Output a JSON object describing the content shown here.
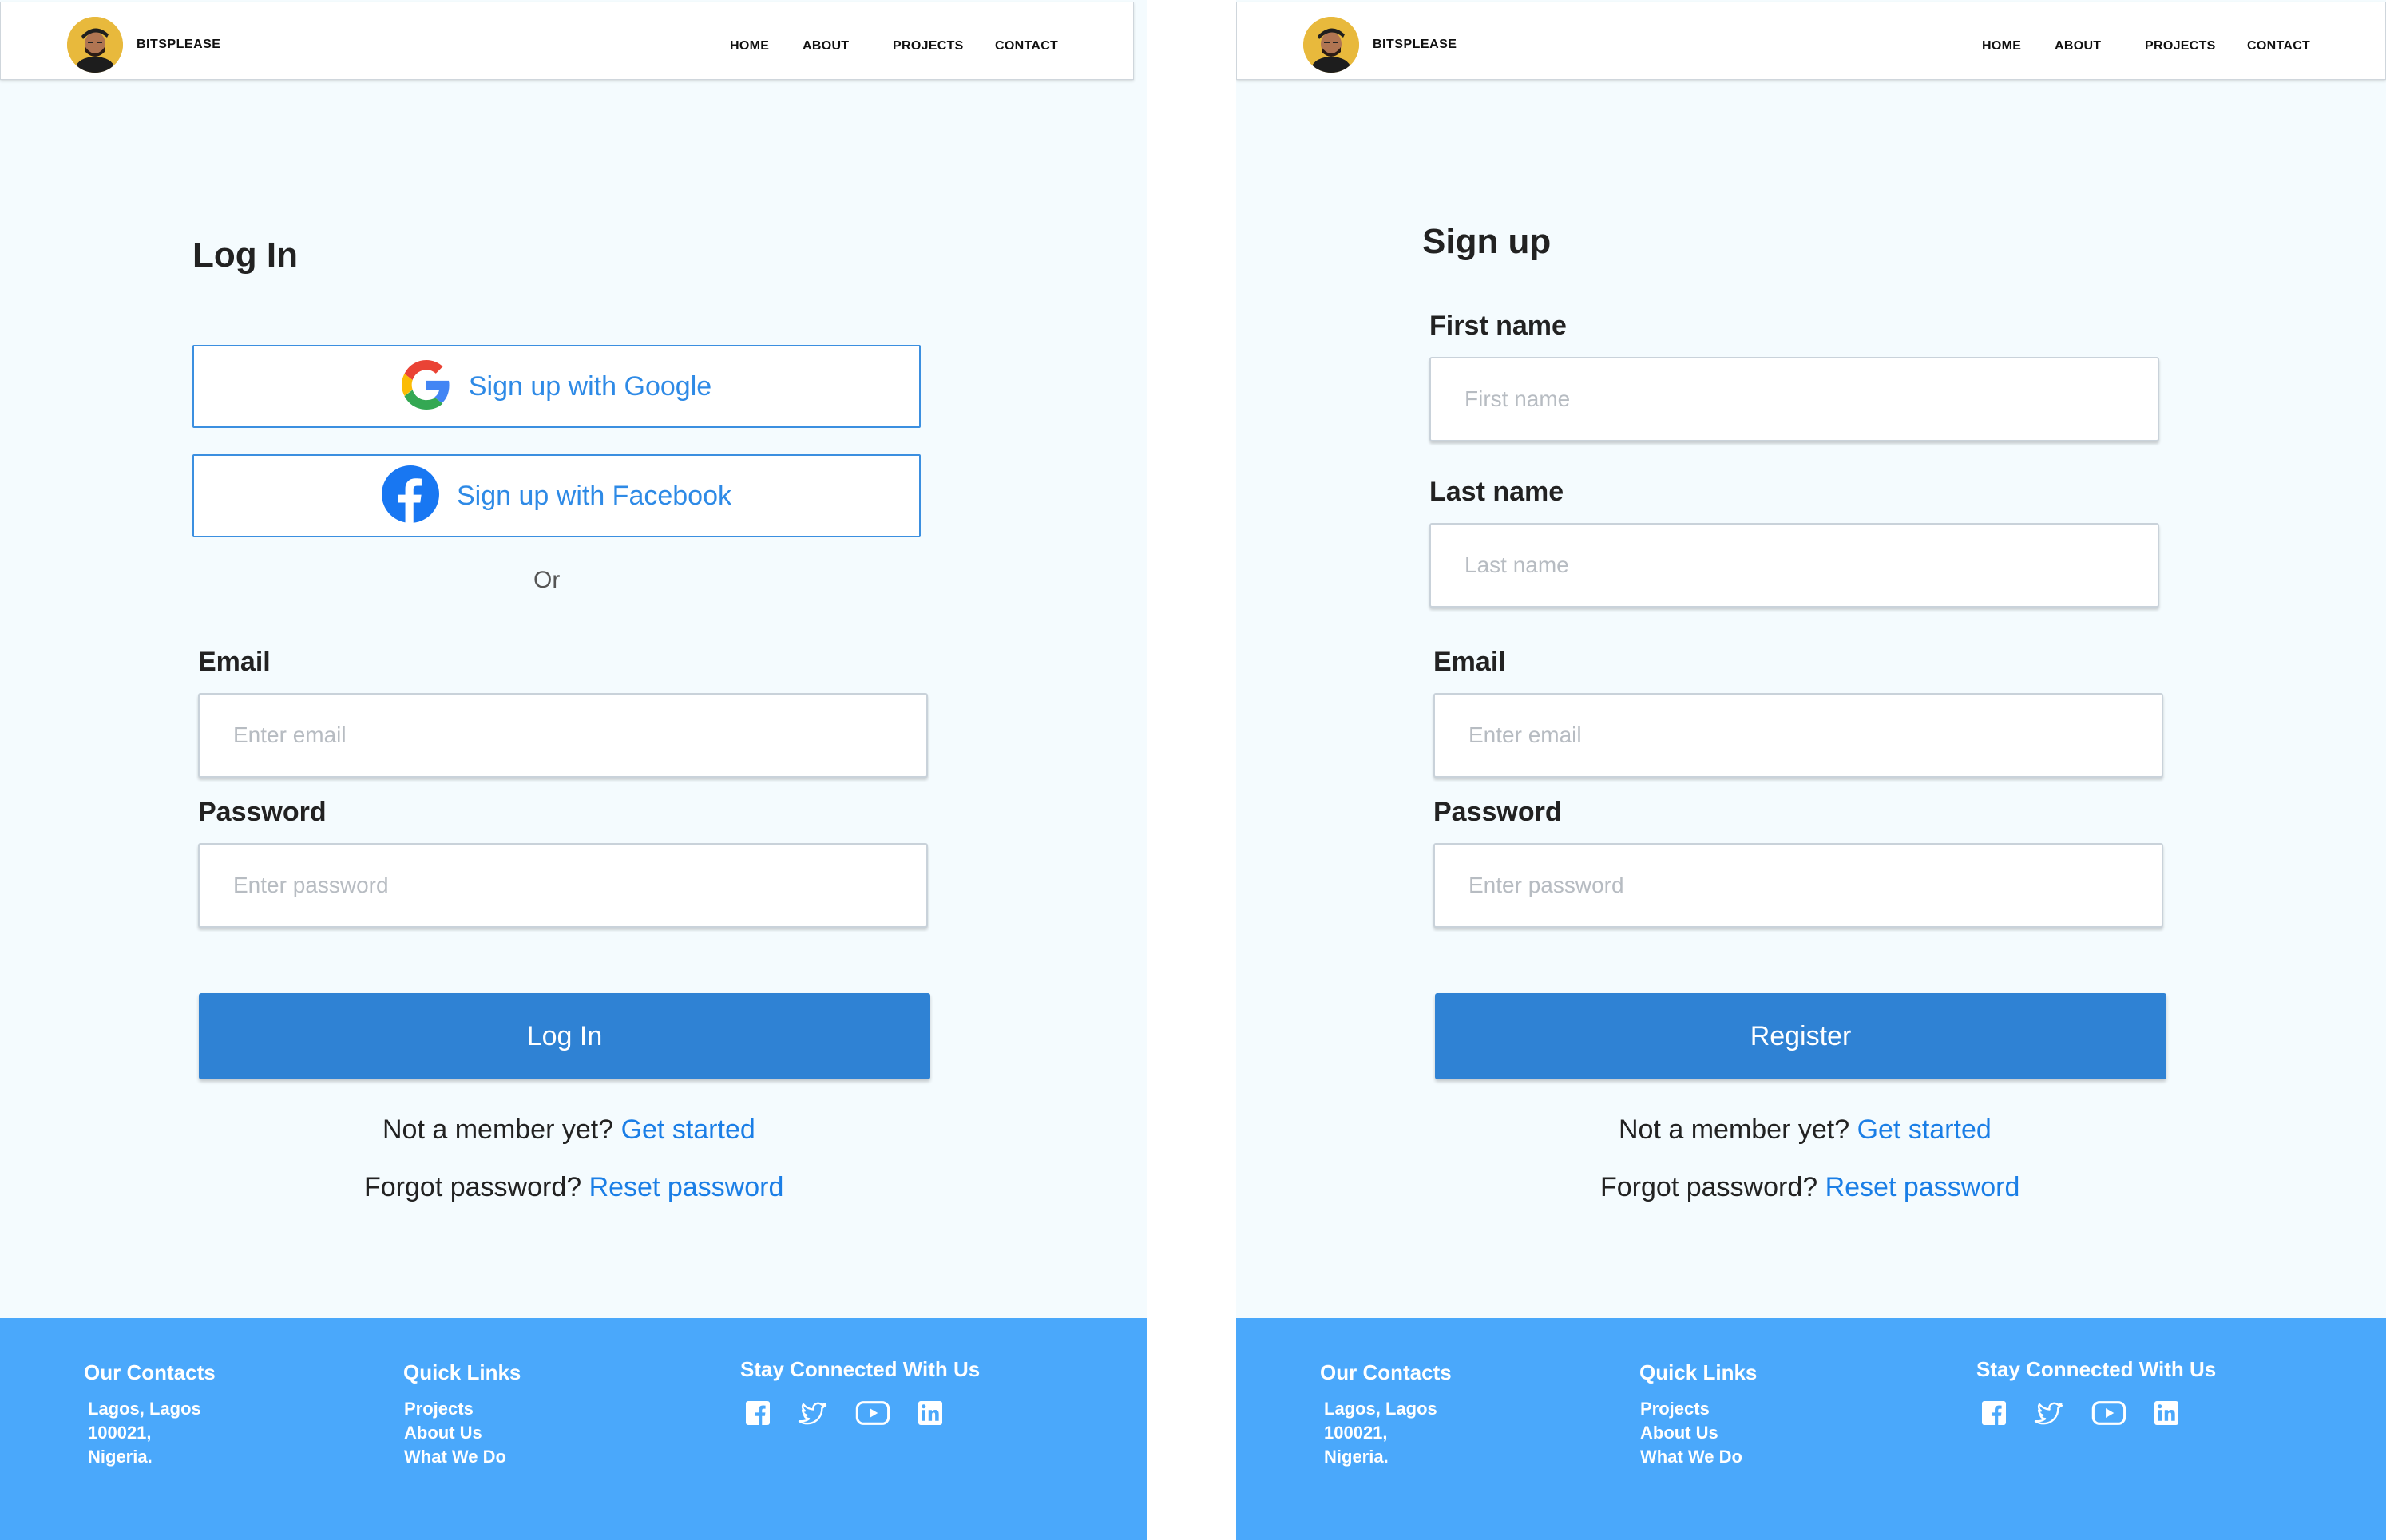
{
  "brand": "BITSPLEASE",
  "nav": {
    "home": "HOME",
    "about": "ABOUT",
    "projects": "PROJECTS",
    "contact": "CONTACT"
  },
  "login": {
    "title": "Log In",
    "google_btn": "Sign up with Google",
    "facebook_btn": "Sign up with Facebook",
    "or": "Or",
    "email_label": "Email",
    "email_placeholder": "Enter email",
    "password_label": "Password",
    "password_placeholder": "Enter password",
    "submit": "Log In",
    "member_prompt": "Not  a member yet?",
    "member_link": "Get started",
    "forgot_prompt": "Forgot password?",
    "forgot_link": "Reset password"
  },
  "signup": {
    "title": "Sign up",
    "first_label": "First name",
    "first_placeholder": "First name",
    "last_label": "Last name",
    "last_placeholder": "Last name",
    "email_label": "Email",
    "email_placeholder": "Enter email",
    "password_label": "Password",
    "password_placeholder": "Enter password",
    "submit": "Register",
    "member_prompt": "Not  a member yet?",
    "member_link": "Get started",
    "forgot_prompt": "Forgot password?",
    "forgot_link": "Reset password"
  },
  "footer": {
    "contacts_title": "Our Contacts",
    "address": [
      "Lagos, Lagos",
      "100021,",
      "Nigeria."
    ],
    "links_title": "Quick Links",
    "links": [
      "Projects",
      "About Us",
      "What We Do"
    ],
    "social_title": "Stay Connected With Us",
    "social_icons": [
      "facebook-icon",
      "twitter-icon",
      "youtube-icon",
      "linkedin-icon"
    ]
  },
  "colors": {
    "primary": "#2f82d4",
    "link": "#1a7ee6",
    "footer": "#4aa8fb",
    "page_bg": "#f4fbfe"
  }
}
